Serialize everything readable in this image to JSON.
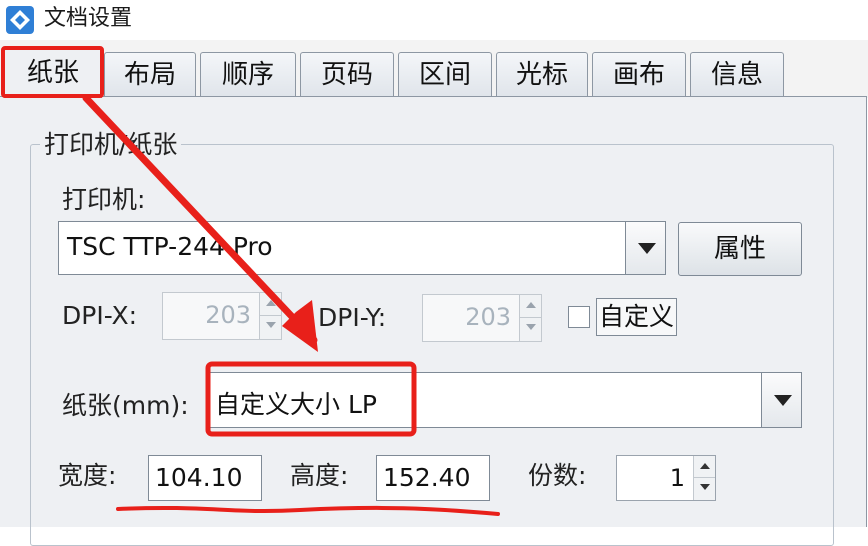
{
  "window": {
    "title": "文档设置"
  },
  "tabs": [
    {
      "label": "纸张",
      "active": true
    },
    {
      "label": "布局"
    },
    {
      "label": "顺序"
    },
    {
      "label": "页码"
    },
    {
      "label": "区间"
    },
    {
      "label": "光标"
    },
    {
      "label": "画布"
    },
    {
      "label": "信息"
    }
  ],
  "group": {
    "title": "打印机/纸张"
  },
  "printer": {
    "label": "打印机:",
    "value": "TSC TTP-244 Pro",
    "properties_button": "属性"
  },
  "dpi": {
    "x_label": "DPI-X:",
    "x_value": "203",
    "y_label": "DPI-Y:",
    "y_value": "203",
    "custom_label": "自定义",
    "custom_checked": false
  },
  "paper": {
    "label": "纸张(mm):",
    "value": "自定义大小 LP"
  },
  "size": {
    "width_label": "宽度:",
    "width_value": "104.10",
    "height_label": "高度:",
    "height_value": "152.40",
    "copies_label": "份数:",
    "copies_value": "1"
  },
  "colors": {
    "annotation_red": "#e8201a",
    "panel_bg": "#eef0f3"
  }
}
